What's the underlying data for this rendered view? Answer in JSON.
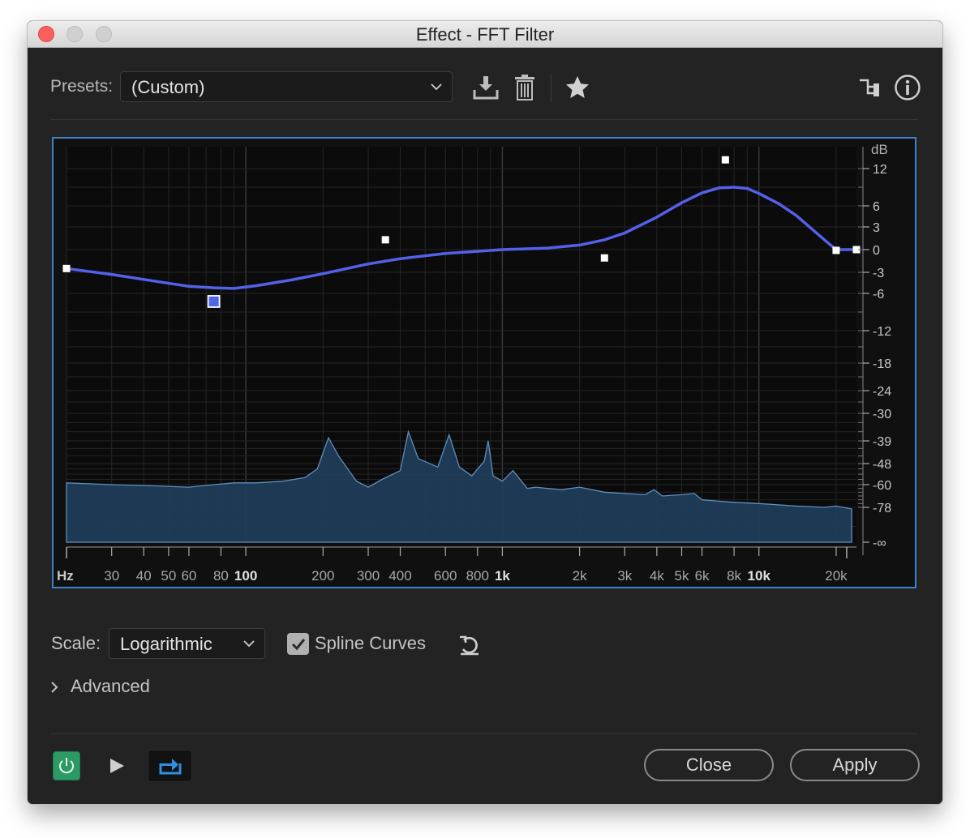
{
  "window": {
    "title": "Effect - FFT Filter"
  },
  "presets": {
    "label": "Presets:",
    "value": "(Custom)"
  },
  "toolbar": {
    "save_icon": "download-icon",
    "delete_icon": "trash-icon",
    "favorite_icon": "star-icon",
    "routing_icon": "routing-icon",
    "info_icon": "info-icon"
  },
  "graph": {
    "db_unit": "dB",
    "db_ticks": [
      {
        "label": "12",
        "db": 12
      },
      {
        "label": "6",
        "db": 6
      },
      {
        "label": "3",
        "db": 3
      },
      {
        "label": "0",
        "db": 0
      },
      {
        "label": "-3",
        "db": -3
      },
      {
        "label": "-6",
        "db": -6
      },
      {
        "label": "-12",
        "db": -12
      },
      {
        "label": "-18",
        "db": -18
      },
      {
        "label": "-24",
        "db": -24
      },
      {
        "label": "-30",
        "db": -30
      },
      {
        "label": "-39",
        "db": -39
      },
      {
        "label": "-48",
        "db": -48
      },
      {
        "label": "-60",
        "db": -60
      },
      {
        "label": "-78",
        "db": -78
      },
      {
        "label": "-∞",
        "db": -100
      }
    ],
    "hz_unit": "Hz",
    "hz_ticks": [
      {
        "label": "30",
        "hz": 30
      },
      {
        "label": "40",
        "hz": 40
      },
      {
        "label": "50",
        "hz": 50
      },
      {
        "label": "60",
        "hz": 60
      },
      {
        "label": "80",
        "hz": 80
      },
      {
        "label": "100",
        "hz": 100,
        "major": true
      },
      {
        "label": "200",
        "hz": 200
      },
      {
        "label": "300",
        "hz": 300
      },
      {
        "label": "400",
        "hz": 400
      },
      {
        "label": "600",
        "hz": 600
      },
      {
        "label": "800",
        "hz": 800
      },
      {
        "label": "1k",
        "hz": 1000,
        "major": true
      },
      {
        "label": "2k",
        "hz": 2000
      },
      {
        "label": "3k",
        "hz": 3000
      },
      {
        "label": "4k",
        "hz": 4000
      },
      {
        "label": "5k",
        "hz": 5000
      },
      {
        "label": "6k",
        "hz": 6000
      },
      {
        "label": "8k",
        "hz": 8000
      },
      {
        "label": "10k",
        "hz": 10000,
        "major": true
      },
      {
        "label": "20k",
        "hz": 20000
      }
    ],
    "freq_range_hz": [
      20,
      24000
    ],
    "curve_color": "#5560e8",
    "spectrum_color": "#5f8fbf",
    "control_points": [
      {
        "hz": 20,
        "db": -2.5
      },
      {
        "hz": 75,
        "db": -7.3,
        "selected": true
      },
      {
        "hz": 350,
        "db": 1.3
      },
      {
        "hz": 2500,
        "db": -1.1
      },
      {
        "hz": 7400,
        "db": 13.2
      },
      {
        "hz": 20000,
        "db": -0.1
      },
      {
        "hz": 24000,
        "db": 0
      }
    ],
    "filter_curve": [
      [
        20,
        -2.5
      ],
      [
        30,
        -3.3
      ],
      [
        45,
        -4.3
      ],
      [
        60,
        -5.0
      ],
      [
        75,
        -5.2
      ],
      [
        90,
        -5.3
      ],
      [
        110,
        -4.9
      ],
      [
        150,
        -4.1
      ],
      [
        200,
        -3.2
      ],
      [
        300,
        -1.9
      ],
      [
        400,
        -1.2
      ],
      [
        600,
        -0.5
      ],
      [
        1000,
        0
      ],
      [
        1500,
        0.2
      ],
      [
        2000,
        0.6
      ],
      [
        2500,
        1.3
      ],
      [
        3000,
        2.2
      ],
      [
        4000,
        4.4
      ],
      [
        5000,
        6.5
      ],
      [
        6000,
        8.1
      ],
      [
        7000,
        8.9
      ],
      [
        8000,
        9.0
      ],
      [
        9000,
        8.8
      ],
      [
        10000,
        8.0
      ],
      [
        12000,
        6.3
      ],
      [
        14000,
        4.6
      ],
      [
        16000,
        2.8
      ],
      [
        18000,
        1.3
      ],
      [
        19500,
        0.3
      ],
      [
        20000,
        0
      ],
      [
        24000,
        0
      ]
    ],
    "spectrum": [
      [
        20,
        -59
      ],
      [
        30,
        -60
      ],
      [
        45,
        -61
      ],
      [
        60,
        -62
      ],
      [
        75,
        -60
      ],
      [
        90,
        -59
      ],
      [
        110,
        -59
      ],
      [
        140,
        -58
      ],
      [
        170,
        -56
      ],
      [
        190,
        -51
      ],
      [
        210,
        -38
      ],
      [
        230,
        -45
      ],
      [
        270,
        -58
      ],
      [
        300,
        -62
      ],
      [
        340,
        -57
      ],
      [
        400,
        -52
      ],
      [
        430,
        -36
      ],
      [
        470,
        -46
      ],
      [
        560,
        -50
      ],
      [
        620,
        -37
      ],
      [
        680,
        -50
      ],
      [
        760,
        -55
      ],
      [
        850,
        -47
      ],
      [
        880,
        -39
      ],
      [
        920,
        -55
      ],
      [
        1000,
        -58
      ],
      [
        1100,
        -52
      ],
      [
        1250,
        -63
      ],
      [
        1350,
        -62
      ],
      [
        1500,
        -63
      ],
      [
        1700,
        -64
      ],
      [
        2000,
        -62
      ],
      [
        2500,
        -66
      ],
      [
        3000,
        -67
      ],
      [
        3600,
        -68
      ],
      [
        3900,
        -64
      ],
      [
        4200,
        -69
      ],
      [
        5000,
        -68
      ],
      [
        5600,
        -67
      ],
      [
        6000,
        -72
      ],
      [
        8000,
        -74
      ],
      [
        10000,
        -75
      ],
      [
        14000,
        -77
      ],
      [
        18000,
        -78
      ],
      [
        20000,
        -77
      ],
      [
        23000,
        -79
      ]
    ]
  },
  "scale": {
    "label": "Scale:",
    "value": "Logarithmic"
  },
  "spline": {
    "label": "Spline Curves",
    "checked": true
  },
  "advanced": {
    "label": "Advanced"
  },
  "buttons": {
    "close": "Close",
    "apply": "Apply"
  }
}
